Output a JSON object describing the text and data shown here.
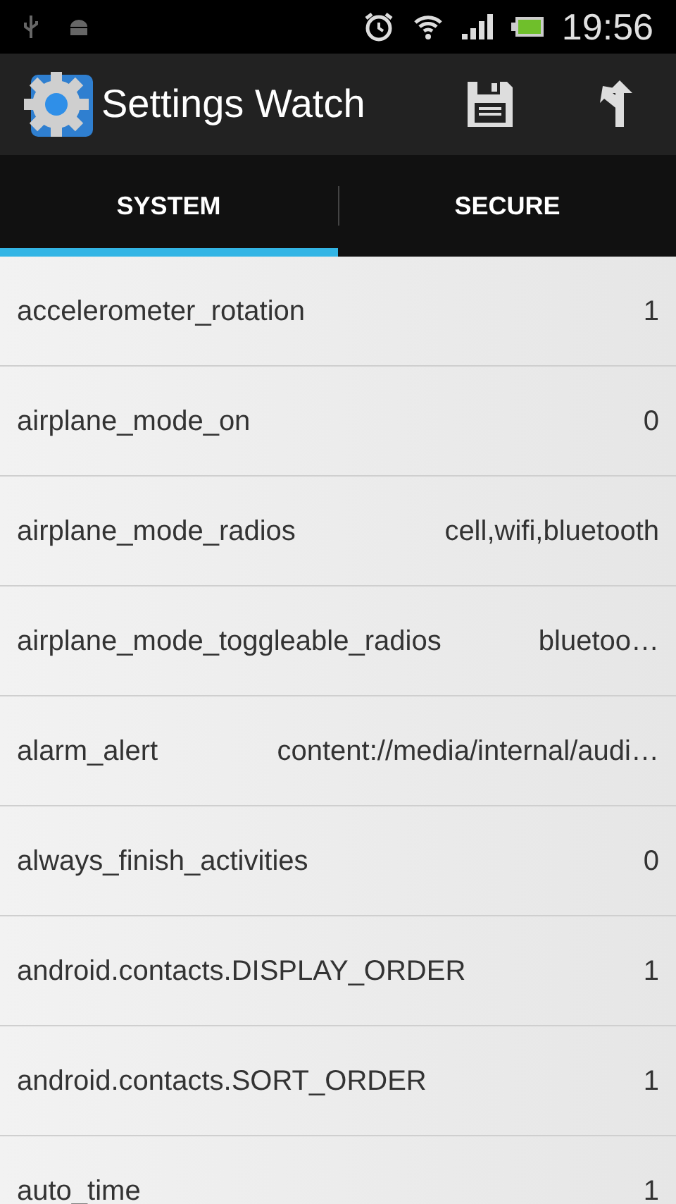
{
  "status_bar": {
    "time": "19:56"
  },
  "action_bar": {
    "title": "Settings Watch"
  },
  "tabs": [
    {
      "label": "SYSTEM",
      "selected": true
    },
    {
      "label": "SECURE",
      "selected": false
    }
  ],
  "settings": [
    {
      "name": "accelerometer_rotation",
      "value": "1"
    },
    {
      "name": "airplane_mode_on",
      "value": "0"
    },
    {
      "name": "airplane_mode_radios",
      "value": "cell,wifi,bluetooth"
    },
    {
      "name": "airplane_mode_toggleable_radios",
      "value": "bluetoo…"
    },
    {
      "name": "alarm_alert",
      "value": "content://media/internal/audi…"
    },
    {
      "name": "always_finish_activities",
      "value": "0"
    },
    {
      "name": "android.contacts.DISPLAY_ORDER",
      "value": "1"
    },
    {
      "name": "android.contacts.SORT_ORDER",
      "value": "1"
    },
    {
      "name": "auto_time",
      "value": "1"
    }
  ]
}
